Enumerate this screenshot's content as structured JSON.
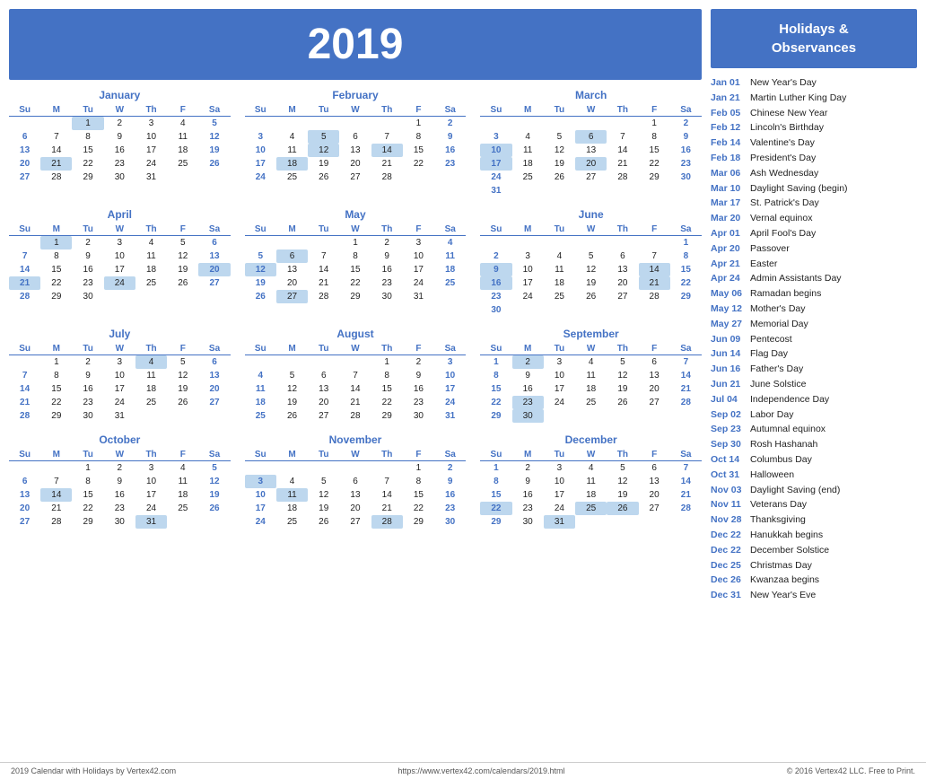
{
  "year": "2019",
  "header": {
    "title": "2019"
  },
  "sidebar": {
    "title": "Holidays &\nObservances",
    "holidays": [
      {
        "date": "Jan 01",
        "name": "New Year's Day"
      },
      {
        "date": "Jan 21",
        "name": "Martin Luther King Day"
      },
      {
        "date": "Feb 05",
        "name": "Chinese New Year"
      },
      {
        "date": "Feb 12",
        "name": "Lincoln's Birthday"
      },
      {
        "date": "Feb 14",
        "name": "Valentine's Day"
      },
      {
        "date": "Feb 18",
        "name": "President's Day"
      },
      {
        "date": "Mar 06",
        "name": "Ash Wednesday"
      },
      {
        "date": "Mar 10",
        "name": "Daylight Saving (begin)"
      },
      {
        "date": "Mar 17",
        "name": "St. Patrick's Day"
      },
      {
        "date": "Mar 20",
        "name": "Vernal equinox"
      },
      {
        "date": "Apr 01",
        "name": "April Fool's Day"
      },
      {
        "date": "Apr 20",
        "name": "Passover"
      },
      {
        "date": "Apr 21",
        "name": "Easter"
      },
      {
        "date": "Apr 24",
        "name": "Admin Assistants Day"
      },
      {
        "date": "May 06",
        "name": "Ramadan begins"
      },
      {
        "date": "May 12",
        "name": "Mother's Day"
      },
      {
        "date": "May 27",
        "name": "Memorial Day"
      },
      {
        "date": "Jun 09",
        "name": "Pentecost"
      },
      {
        "date": "Jun 14",
        "name": "Flag Day"
      },
      {
        "date": "Jun 16",
        "name": "Father's Day"
      },
      {
        "date": "Jun 21",
        "name": "June Solstice"
      },
      {
        "date": "Jul 04",
        "name": "Independence Day"
      },
      {
        "date": "Sep 02",
        "name": "Labor Day"
      },
      {
        "date": "Sep 23",
        "name": "Autumnal equinox"
      },
      {
        "date": "Sep 30",
        "name": "Rosh Hashanah"
      },
      {
        "date": "Oct 14",
        "name": "Columbus Day"
      },
      {
        "date": "Oct 31",
        "name": "Halloween"
      },
      {
        "date": "Nov 03",
        "name": "Daylight Saving (end)"
      },
      {
        "date": "Nov 11",
        "name": "Veterans Day"
      },
      {
        "date": "Nov 28",
        "name": "Thanksgiving"
      },
      {
        "date": "Dec 22",
        "name": "Hanukkah begins"
      },
      {
        "date": "Dec 22",
        "name": "December Solstice"
      },
      {
        "date": "Dec 25",
        "name": "Christmas Day"
      },
      {
        "date": "Dec 26",
        "name": "Kwanzaa begins"
      },
      {
        "date": "Dec 31",
        "name": "New Year's Eve"
      }
    ]
  },
  "footer": {
    "left": "2019 Calendar with Holidays by Vertex42.com",
    "center": "https://www.vertex42.com/calendars/2019.html",
    "right": "© 2016 Vertex42 LLC. Free to Print."
  },
  "months": [
    {
      "name": "January",
      "weeks": [
        [
          "",
          "",
          1,
          2,
          3,
          4,
          5
        ],
        [
          6,
          7,
          8,
          9,
          10,
          11,
          12
        ],
        [
          13,
          14,
          15,
          16,
          17,
          18,
          19
        ],
        [
          20,
          21,
          22,
          23,
          24,
          25,
          26
        ],
        [
          27,
          28,
          29,
          30,
          31,
          "",
          ""
        ]
      ],
      "highlighted": [
        1,
        21
      ]
    },
    {
      "name": "February",
      "weeks": [
        [
          "",
          "",
          "",
          "",
          "",
          1,
          2
        ],
        [
          3,
          4,
          5,
          6,
          7,
          8,
          9
        ],
        [
          10,
          11,
          12,
          13,
          14,
          15,
          16
        ],
        [
          17,
          18,
          19,
          20,
          21,
          22,
          23
        ],
        [
          24,
          25,
          26,
          27,
          28,
          "",
          ""
        ]
      ],
      "highlighted": [
        5,
        12,
        14,
        18
      ]
    },
    {
      "name": "March",
      "weeks": [
        [
          "",
          "",
          "",
          "",
          "",
          1,
          2
        ],
        [
          3,
          4,
          5,
          6,
          7,
          8,
          9
        ],
        [
          10,
          11,
          12,
          13,
          14,
          15,
          16
        ],
        [
          17,
          18,
          19,
          20,
          21,
          22,
          23
        ],
        [
          24,
          25,
          26,
          27,
          28,
          29,
          30
        ],
        [
          31,
          "",
          "",
          "",
          "",
          "",
          ""
        ]
      ],
      "highlighted": [
        6,
        10,
        17,
        20
      ]
    },
    {
      "name": "April",
      "weeks": [
        [
          "",
          1,
          2,
          3,
          4,
          5,
          6
        ],
        [
          7,
          8,
          9,
          10,
          11,
          12,
          13
        ],
        [
          14,
          15,
          16,
          17,
          18,
          19,
          20
        ],
        [
          21,
          22,
          23,
          24,
          25,
          26,
          27
        ],
        [
          28,
          29,
          30,
          "",
          "",
          "",
          ""
        ]
      ],
      "highlighted": [
        1,
        20,
        21,
        24
      ]
    },
    {
      "name": "May",
      "weeks": [
        [
          "",
          "",
          "",
          1,
          2,
          3,
          4
        ],
        [
          5,
          6,
          7,
          8,
          9,
          10,
          11
        ],
        [
          12,
          13,
          14,
          15,
          16,
          17,
          18
        ],
        [
          19,
          20,
          21,
          22,
          23,
          24,
          25
        ],
        [
          26,
          27,
          28,
          29,
          30,
          31,
          ""
        ]
      ],
      "highlighted": [
        6,
        12,
        27
      ]
    },
    {
      "name": "June",
      "weeks": [
        [
          "",
          "",
          "",
          "",
          "",
          "",
          1
        ],
        [
          2,
          3,
          4,
          5,
          6,
          7,
          8
        ],
        [
          9,
          10,
          11,
          12,
          13,
          14,
          15
        ],
        [
          16,
          17,
          18,
          19,
          20,
          21,
          22
        ],
        [
          23,
          24,
          25,
          26,
          27,
          28,
          29
        ],
        [
          30,
          "",
          "",
          "",
          "",
          "",
          ""
        ]
      ],
      "highlighted": [
        9,
        14,
        16,
        21
      ]
    },
    {
      "name": "July",
      "weeks": [
        [
          "",
          1,
          2,
          3,
          4,
          5,
          6
        ],
        [
          7,
          8,
          9,
          10,
          11,
          12,
          13
        ],
        [
          14,
          15,
          16,
          17,
          18,
          19,
          20
        ],
        [
          21,
          22,
          23,
          24,
          25,
          26,
          27
        ],
        [
          28,
          29,
          30,
          31,
          "",
          "",
          ""
        ]
      ],
      "highlighted": [
        4
      ]
    },
    {
      "name": "August",
      "weeks": [
        [
          "",
          "",
          "",
          "",
          1,
          2,
          3
        ],
        [
          4,
          5,
          6,
          7,
          8,
          9,
          10
        ],
        [
          11,
          12,
          13,
          14,
          15,
          16,
          17
        ],
        [
          18,
          19,
          20,
          21,
          22,
          23,
          24
        ],
        [
          25,
          26,
          27,
          28,
          29,
          30,
          31
        ]
      ],
      "highlighted": []
    },
    {
      "name": "September",
      "weeks": [
        [
          1,
          2,
          3,
          4,
          5,
          6,
          7
        ],
        [
          8,
          9,
          10,
          11,
          12,
          13,
          14
        ],
        [
          15,
          16,
          17,
          18,
          19,
          20,
          21
        ],
        [
          22,
          23,
          24,
          25,
          26,
          27,
          28
        ],
        [
          29,
          30,
          "",
          "",
          "",
          "",
          ""
        ]
      ],
      "highlighted": [
        2,
        23,
        30
      ]
    },
    {
      "name": "October",
      "weeks": [
        [
          "",
          "",
          1,
          2,
          3,
          4,
          5
        ],
        [
          6,
          7,
          8,
          9,
          10,
          11,
          12
        ],
        [
          13,
          14,
          15,
          16,
          17,
          18,
          19
        ],
        [
          20,
          21,
          22,
          23,
          24,
          25,
          26
        ],
        [
          27,
          28,
          29,
          30,
          31,
          "",
          ""
        ]
      ],
      "highlighted": [
        14,
        31
      ]
    },
    {
      "name": "November",
      "weeks": [
        [
          "",
          "",
          "",
          "",
          "",
          1,
          2
        ],
        [
          3,
          4,
          5,
          6,
          7,
          8,
          9
        ],
        [
          10,
          11,
          12,
          13,
          14,
          15,
          16
        ],
        [
          17,
          18,
          19,
          20,
          21,
          22,
          23
        ],
        [
          24,
          25,
          26,
          27,
          28,
          29,
          30
        ]
      ],
      "highlighted": [
        3,
        11,
        28
      ]
    },
    {
      "name": "December",
      "weeks": [
        [
          1,
          2,
          3,
          4,
          5,
          6,
          7
        ],
        [
          8,
          9,
          10,
          11,
          12,
          13,
          14
        ],
        [
          15,
          16,
          17,
          18,
          19,
          20,
          21
        ],
        [
          22,
          23,
          24,
          25,
          26,
          27,
          28
        ],
        [
          29,
          30,
          31,
          "",
          "",
          "",
          ""
        ]
      ],
      "highlighted": [
        22,
        25,
        26,
        31
      ]
    }
  ],
  "days": [
    "Su",
    "M",
    "Tu",
    "W",
    "Th",
    "F",
    "Sa"
  ]
}
